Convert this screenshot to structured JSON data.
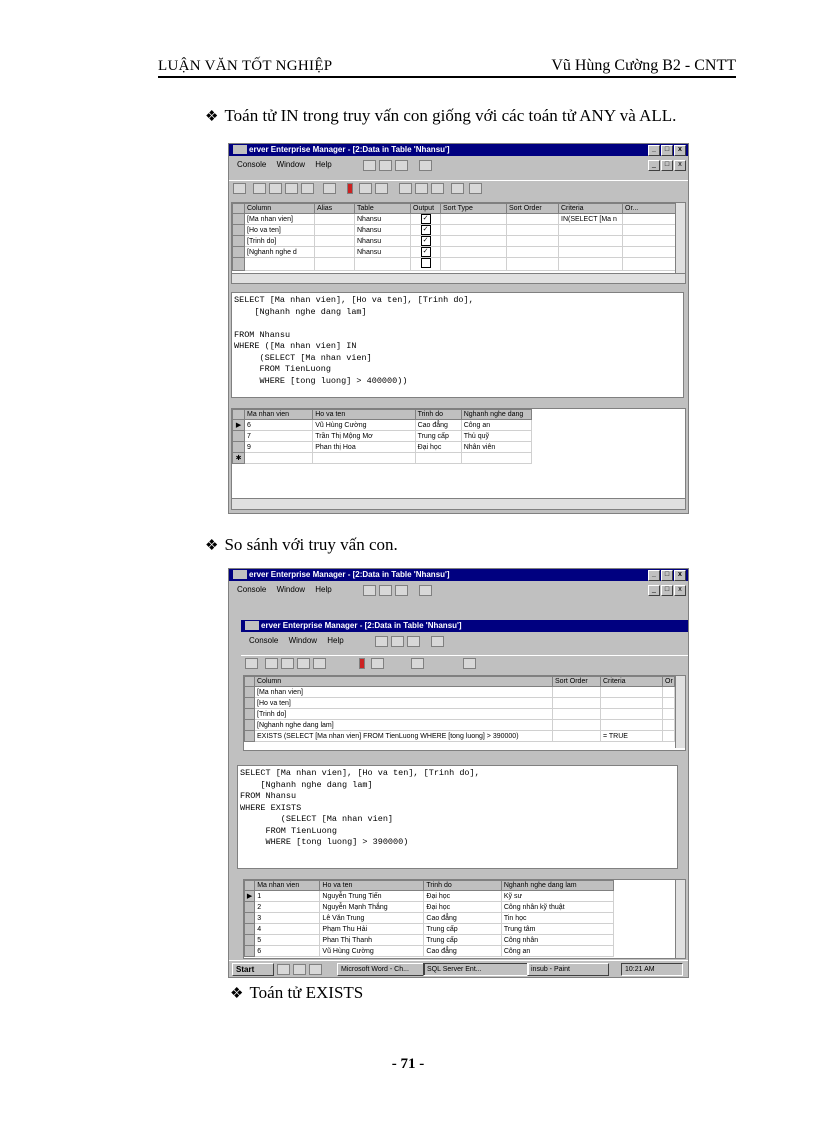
{
  "header": {
    "left": "LUẬN VĂN TỐT NGHIỆP",
    "right": "Vũ Hùng Cường   B2 - CNTT"
  },
  "bullets": {
    "b1": "Toán tử IN trong truy vấn con giống với các toán tử ANY và ALL.",
    "b2": "So sánh với truy vấn con.",
    "b3": "Toán tử EXISTS"
  },
  "page_number": "- 71 -",
  "window_title": "erver Enterprise Manager - [2:Data in Table 'Nhansu']",
  "window_buttons": [
    "_",
    "□",
    "x"
  ],
  "menu": {
    "console": "Console",
    "window": "Window",
    "help": "Help"
  },
  "shot1": {
    "design_headers": [
      "Column",
      "Alias",
      "Table",
      "Output",
      "Sort Type",
      "Sort Order",
      "Criteria",
      "Or..."
    ],
    "design_rows": [
      {
        "column": "[Ma nhan vien]",
        "table": "Nhansu",
        "criteria": "IN(SELECT [Ma n"
      },
      {
        "column": "[Ho va ten]",
        "table": "Nhansu",
        "criteria": ""
      },
      {
        "column": "[Trinh do]",
        "table": "Nhansu",
        "criteria": ""
      },
      {
        "column": "[Nghanh nghe d",
        "table": "Nhansu",
        "criteria": ""
      }
    ],
    "sql": "SELECT [Ma nhan vien], [Ho va ten], [Trinh do],\n    [Nghanh nghe dang lam]\n\nFROM Nhansu\nWHERE ([Ma nhan vien] IN\n     (SELECT [Ma nhan vien]\n     FROM TienLuong\n     WHERE [tong luong] > 400000))",
    "result_headers": [
      "Ma nhan vien",
      "Ho va ten",
      "Trinh do",
      "Nghanh nghe dang"
    ],
    "result_rows": [
      [
        "6",
        "Vũ Hùng Cường",
        "Cao đẳng",
        "Công an"
      ],
      [
        "7",
        "Trần Thị Mộng Mơ",
        "Trung cấp",
        "Thủ quỹ"
      ],
      [
        "9",
        "Phan thị Hoa",
        "Đại học",
        "Nhân viên"
      ]
    ]
  },
  "shot2": {
    "design_headers": [
      "Column",
      "Sort Order",
      "Criteria",
      "Or"
    ],
    "design_rows": [
      {
        "column": "[Ma nhan vien]",
        "criteria": ""
      },
      {
        "column": "[Ho va ten]",
        "criteria": ""
      },
      {
        "column": "[Trinh do]",
        "criteria": ""
      },
      {
        "column": "[Nghanh nghe dang lam]",
        "criteria": ""
      },
      {
        "column": "EXISTS (SELECT [Ma nhan vien] FROM TienLuong WHERE [tong luong] > 390000)",
        "criteria": "= TRUE"
      }
    ],
    "sql": "SELECT [Ma nhan vien], [Ho va ten], [Trinh do],\n    [Nghanh nghe dang lam]\nFROM Nhansu\nWHERE EXISTS\n        (SELECT [Ma nhan vien]\n     FROM TienLuong\n     WHERE [tong luong] > 390000)",
    "result_headers": [
      "Ma nhan vien",
      "Ho va ten",
      "Trinh do",
      "Nghanh nghe dang lam"
    ],
    "result_rows": [
      [
        "1",
        "Nguyễn Trung Tiến",
        "Đại học",
        "Kỹ sư"
      ],
      [
        "2",
        "Nguyễn Mạnh Thắng",
        "Đại học",
        "Công nhân kỹ thuật"
      ],
      [
        "3",
        "Lê Văn Trung",
        "Cao đẳng",
        "Tin học"
      ],
      [
        "4",
        "Phạm Thu Hải",
        "Trung cấp",
        "Trung tâm"
      ],
      [
        "5",
        "Phan Thị Thanh",
        "Trung cấp",
        "Công nhân"
      ],
      [
        "6",
        "Vũ Hùng Cường",
        "Cao đẳng",
        "Công an"
      ]
    ],
    "taskbar": {
      "start": "Start",
      "items": [
        "Microsoft Word - Ch...",
        "SQL Server Ent...",
        "insub - Paint"
      ],
      "clock": "10:21 AM"
    }
  }
}
